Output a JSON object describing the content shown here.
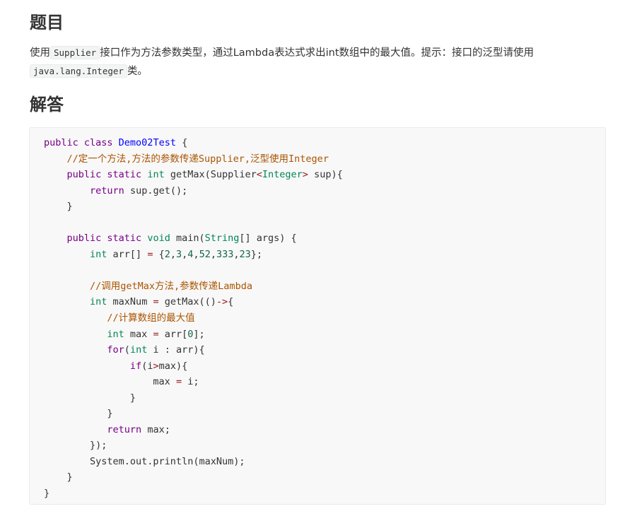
{
  "question": {
    "heading": "题目",
    "text_before": "使用",
    "code1": "Supplier",
    "text_middle": "接口作为方法参数类型，通过Lambda表达式求出int数组中的最大值。提示：接口的泛型请使用",
    "code2": "java.lang.Integer",
    "text_after": "类。"
  },
  "answer": {
    "heading": "解答",
    "code_lines": [
      [
        {
          "t": "public class ",
          "c": "kw"
        },
        {
          "t": "Demo02Test",
          "c": "cls"
        },
        {
          "t": " {",
          "c": ""
        }
      ],
      [
        {
          "t": "    ",
          "c": ""
        },
        {
          "t": "//定一个方法,方法的参数传递Supplier,泛型使用Integer",
          "c": "cm"
        }
      ],
      [
        {
          "t": "    ",
          "c": ""
        },
        {
          "t": "public static ",
          "c": "kw"
        },
        {
          "t": "int",
          "c": "ty"
        },
        {
          "t": " getMax(Supplier",
          "c": ""
        },
        {
          "t": "<",
          "c": "op"
        },
        {
          "t": "Integer",
          "c": "ty"
        },
        {
          "t": ">",
          "c": "op"
        },
        {
          "t": " sup){",
          "c": ""
        }
      ],
      [
        {
          "t": "        ",
          "c": ""
        },
        {
          "t": "return",
          "c": "kw"
        },
        {
          "t": " sup.get();",
          "c": ""
        }
      ],
      [
        {
          "t": "    }",
          "c": ""
        }
      ],
      [
        {
          "t": "",
          "c": ""
        }
      ],
      [
        {
          "t": "    ",
          "c": ""
        },
        {
          "t": "public static ",
          "c": "kw"
        },
        {
          "t": "void",
          "c": "ty"
        },
        {
          "t": " main(",
          "c": ""
        },
        {
          "t": "String",
          "c": "ty"
        },
        {
          "t": "[] args) {",
          "c": ""
        }
      ],
      [
        {
          "t": "        ",
          "c": ""
        },
        {
          "t": "int",
          "c": "ty"
        },
        {
          "t": " arr[] ",
          "c": ""
        },
        {
          "t": "=",
          "c": "op"
        },
        {
          "t": " {",
          "c": ""
        },
        {
          "t": "2",
          "c": "num"
        },
        {
          "t": ",",
          "c": ""
        },
        {
          "t": "3",
          "c": "num"
        },
        {
          "t": ",",
          "c": ""
        },
        {
          "t": "4",
          "c": "num"
        },
        {
          "t": ",",
          "c": ""
        },
        {
          "t": "52",
          "c": "num"
        },
        {
          "t": ",",
          "c": ""
        },
        {
          "t": "333",
          "c": "num"
        },
        {
          "t": ",",
          "c": ""
        },
        {
          "t": "23",
          "c": "num"
        },
        {
          "t": "};",
          "c": ""
        }
      ],
      [
        {
          "t": "",
          "c": ""
        }
      ],
      [
        {
          "t": "        ",
          "c": ""
        },
        {
          "t": "//调用getMax方法,参数传递Lambda",
          "c": "cm"
        }
      ],
      [
        {
          "t": "        ",
          "c": ""
        },
        {
          "t": "int",
          "c": "ty"
        },
        {
          "t": " maxNum ",
          "c": ""
        },
        {
          "t": "=",
          "c": "op"
        },
        {
          "t": " getMax(()",
          "c": ""
        },
        {
          "t": "->",
          "c": "op"
        },
        {
          "t": "{",
          "c": ""
        }
      ],
      [
        {
          "t": "           ",
          "c": ""
        },
        {
          "t": "//计算数组的最大值",
          "c": "cm"
        }
      ],
      [
        {
          "t": "           ",
          "c": ""
        },
        {
          "t": "int",
          "c": "ty"
        },
        {
          "t": " max ",
          "c": ""
        },
        {
          "t": "=",
          "c": "op"
        },
        {
          "t": " arr[",
          "c": ""
        },
        {
          "t": "0",
          "c": "num"
        },
        {
          "t": "];",
          "c": ""
        }
      ],
      [
        {
          "t": "           ",
          "c": ""
        },
        {
          "t": "for",
          "c": "kw"
        },
        {
          "t": "(",
          "c": ""
        },
        {
          "t": "int",
          "c": "ty"
        },
        {
          "t": " i : arr){",
          "c": ""
        }
      ],
      [
        {
          "t": "               ",
          "c": ""
        },
        {
          "t": "if",
          "c": "kw"
        },
        {
          "t": "(i",
          "c": ""
        },
        {
          "t": ">",
          "c": "op"
        },
        {
          "t": "max){",
          "c": ""
        }
      ],
      [
        {
          "t": "                   max ",
          "c": ""
        },
        {
          "t": "=",
          "c": "op"
        },
        {
          "t": " i;",
          "c": ""
        }
      ],
      [
        {
          "t": "               }",
          "c": ""
        }
      ],
      [
        {
          "t": "           }",
          "c": ""
        }
      ],
      [
        {
          "t": "           ",
          "c": ""
        },
        {
          "t": "return",
          "c": "kw"
        },
        {
          "t": " max;",
          "c": ""
        }
      ],
      [
        {
          "t": "        });",
          "c": ""
        }
      ],
      [
        {
          "t": "        System.out.println(maxNum);",
          "c": ""
        }
      ],
      [
        {
          "t": "    }",
          "c": ""
        }
      ],
      [
        {
          "t": "}",
          "c": ""
        }
      ]
    ]
  }
}
